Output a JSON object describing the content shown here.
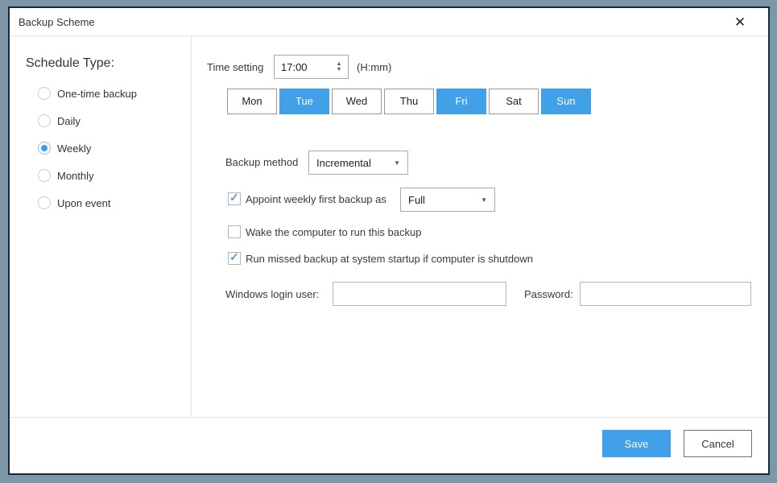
{
  "window": {
    "title": "Backup Scheme"
  },
  "icons": {
    "close": "✕",
    "check": "✓",
    "dropdown_arrow": "▼",
    "spin_up": "▲",
    "spin_down": "▼"
  },
  "sidebar": {
    "heading": "Schedule Type:",
    "options": [
      {
        "label": "One-time backup",
        "selected": false
      },
      {
        "label": "Daily",
        "selected": false
      },
      {
        "label": "Weekly",
        "selected": true
      },
      {
        "label": "Monthly",
        "selected": false
      },
      {
        "label": "Upon event",
        "selected": false
      }
    ]
  },
  "main": {
    "time": {
      "label": "Time setting",
      "value": "17:00",
      "hint": "(H:mm)"
    },
    "days": {
      "items": [
        {
          "label": "Mon",
          "selected": false
        },
        {
          "label": "Tue",
          "selected": true
        },
        {
          "label": "Wed",
          "selected": false
        },
        {
          "label": "Thu",
          "selected": false
        },
        {
          "label": "Fri",
          "selected": true
        },
        {
          "label": "Sat",
          "selected": false
        },
        {
          "label": "Sun",
          "selected": true
        }
      ]
    },
    "backup_method": {
      "label": "Backup method",
      "selected_value": "Incremental"
    },
    "appoint": {
      "label": "Appoint weekly first backup as",
      "checked": true,
      "selected_value": "Full"
    },
    "wake": {
      "label": "Wake the computer to run this backup",
      "checked": false
    },
    "run_missed": {
      "label": "Run missed backup at system startup if computer is shutdown",
      "checked": true
    },
    "credentials": {
      "user_label": "Windows login user:",
      "user_value": "",
      "password_label": "Password:",
      "password_value": ""
    }
  },
  "footer": {
    "save_label": "Save",
    "cancel_label": "Cancel"
  },
  "colors": {
    "accent_blue": "#42a0e8",
    "check_blue": "#4d9add",
    "dialog_border": "#16293f",
    "desktop_background": "#7e97a8"
  }
}
